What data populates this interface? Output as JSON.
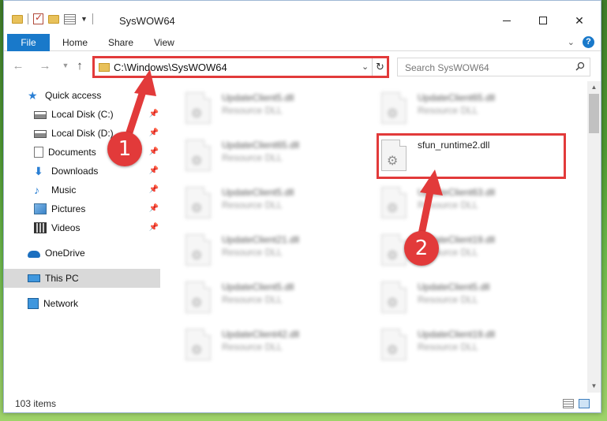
{
  "window": {
    "title": "SysWOW64"
  },
  "ribbon": {
    "tabs": [
      "File",
      "Home",
      "Share",
      "View"
    ],
    "help": "?"
  },
  "address": {
    "path": "C:\\Windows\\SysWOW64"
  },
  "search": {
    "placeholder": "Search SysWOW64"
  },
  "sidebar": {
    "items": [
      {
        "label": "Quick access",
        "icon": "star-icon"
      },
      {
        "label": "Local Disk (C:)",
        "icon": "disk-icon",
        "pinned": true
      },
      {
        "label": "Local Disk (D:)",
        "icon": "disk-icon",
        "pinned": true
      },
      {
        "label": "Documents",
        "icon": "documents-icon",
        "pinned": true
      },
      {
        "label": "Downloads",
        "icon": "download-icon",
        "pinned": true
      },
      {
        "label": "Music",
        "icon": "music-icon",
        "pinned": true
      },
      {
        "label": "Pictures",
        "icon": "pictures-icon",
        "pinned": true
      },
      {
        "label": "Videos",
        "icon": "videos-icon",
        "pinned": true
      },
      {
        "label": "OneDrive",
        "icon": "cloud-icon"
      },
      {
        "label": "This PC",
        "icon": "computer-icon",
        "selected": true
      },
      {
        "label": "Network",
        "icon": "network-icon"
      }
    ]
  },
  "files": {
    "left_column": [
      {
        "name": "UpdateClient5.dll",
        "type": "Resource DLL"
      },
      {
        "name": "UpdateClient65.dll",
        "type": "Resource DLL"
      },
      {
        "name": "UpdateClient5.dll",
        "type": "Resource DLL"
      },
      {
        "name": "UpdateClient21.dll",
        "type": "Resource DLL"
      },
      {
        "name": "UpdateClient5.dll",
        "type": "Resource DLL"
      },
      {
        "name": "UpdateClient42.dll",
        "type": "Resource DLL"
      }
    ],
    "right_column": [
      {
        "name": "UpdateClient65.dll",
        "type": "Resource DLL"
      },
      {
        "name": "sfun_runtime2.dll",
        "type": ""
      },
      {
        "name": "UpdateClient63.dll",
        "type": "Resource DLL"
      },
      {
        "name": "UpdateClient19.dll",
        "type": "Resource DLL"
      },
      {
        "name": "UpdateClient5.dll",
        "type": "Resource DLL"
      },
      {
        "name": "UpdateClient19.dll",
        "type": "Resource DLL"
      }
    ]
  },
  "status": {
    "item_count": "103 items"
  },
  "callouts": {
    "step1": "1",
    "step2": "2"
  },
  "colors": {
    "accent": "#1979ca",
    "highlight": "#e23a3a"
  }
}
